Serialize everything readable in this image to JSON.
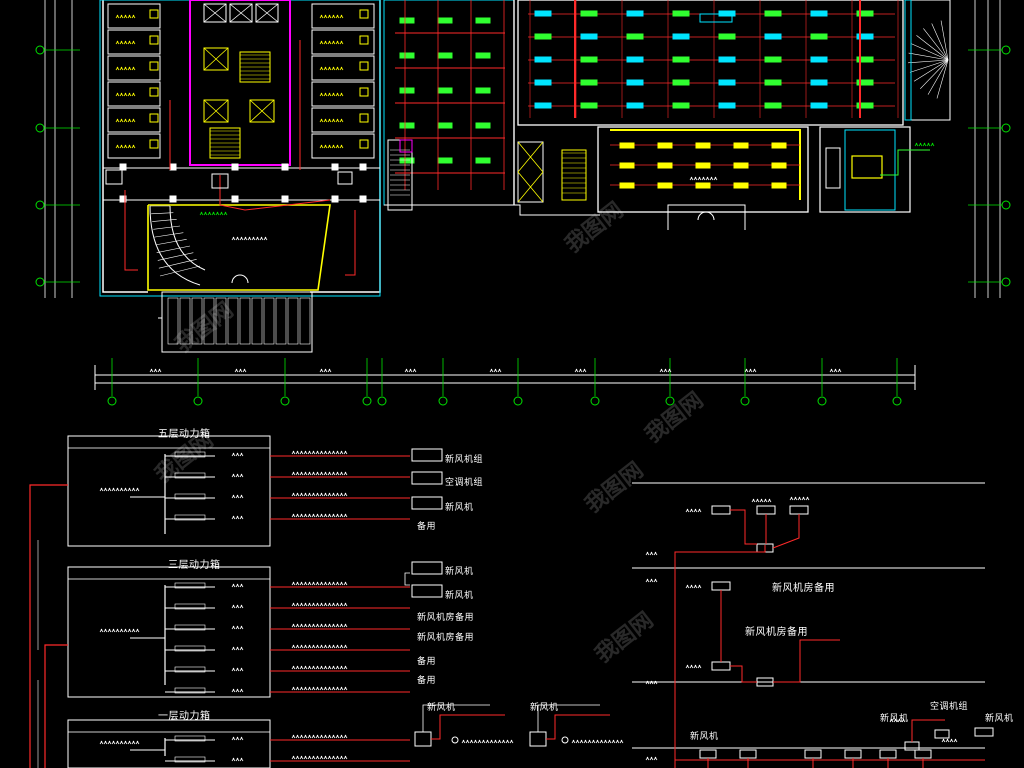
{
  "colors": {
    "background": "#000000",
    "wall": "#ffffff",
    "room_outline": "#00e5ff",
    "cable": "#ff2a2a",
    "dimension": "#00e400",
    "fixture": "#ffff00",
    "core": "#ff00ff",
    "label": "#ffffff",
    "pipe": "#30ff30"
  },
  "icons": [
    "stair-icon",
    "elevator-icon",
    "fan-coil-icon",
    "distribution-box-icon",
    "grid-axis-bubble-icon"
  ],
  "panels": {
    "p5f": {
      "title": "五层动力箱",
      "right_labels": [
        "新风机组",
        "空调机组",
        "新风机",
        "备用"
      ]
    },
    "p3f": {
      "title": "三层动力箱",
      "right_labels": [
        "新风机",
        "新风机",
        "新风机房备用",
        "新风机房备用",
        "备用",
        "备用"
      ]
    },
    "p1f": {
      "title": "一层动力箱",
      "right_labels": [
        "新风机",
        "新风机"
      ]
    }
  },
  "riser": {
    "right_text_1": "新风机房备用",
    "right_text_2": "新风机房备用",
    "bottom_labels": [
      "新风机",
      "空调机组",
      "新风机",
      "新风机"
    ]
  },
  "watermark": "我图网"
}
